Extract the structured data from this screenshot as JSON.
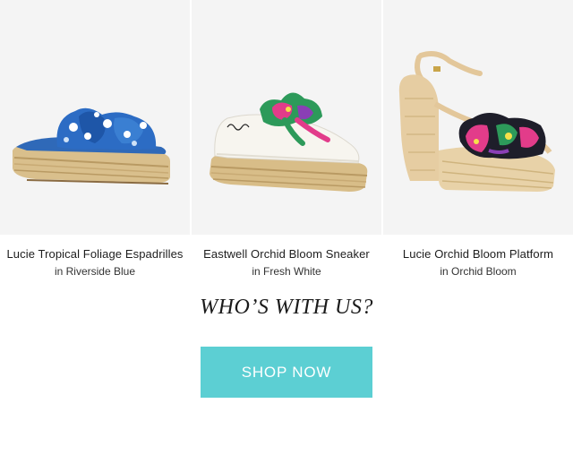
{
  "products": [
    {
      "name": "Lucie Tropical Foliage Espadrilles",
      "variant": "in Riverside Blue"
    },
    {
      "name": "Eastwell Orchid Bloom Sneaker",
      "variant": "in Fresh White"
    },
    {
      "name": "Lucie Orchid Bloom Platform",
      "variant": "in Orchid Bloom"
    }
  ],
  "headline": "WHO’S WITH US?",
  "cta": {
    "label": "SHOP NOW"
  },
  "colors": {
    "cta_background": "#5ccfd3",
    "photo_background": "#f4f4f4"
  },
  "icons": [
    "espadrille-slide-image",
    "sneaker-image",
    "platform-sandal-image"
  ]
}
